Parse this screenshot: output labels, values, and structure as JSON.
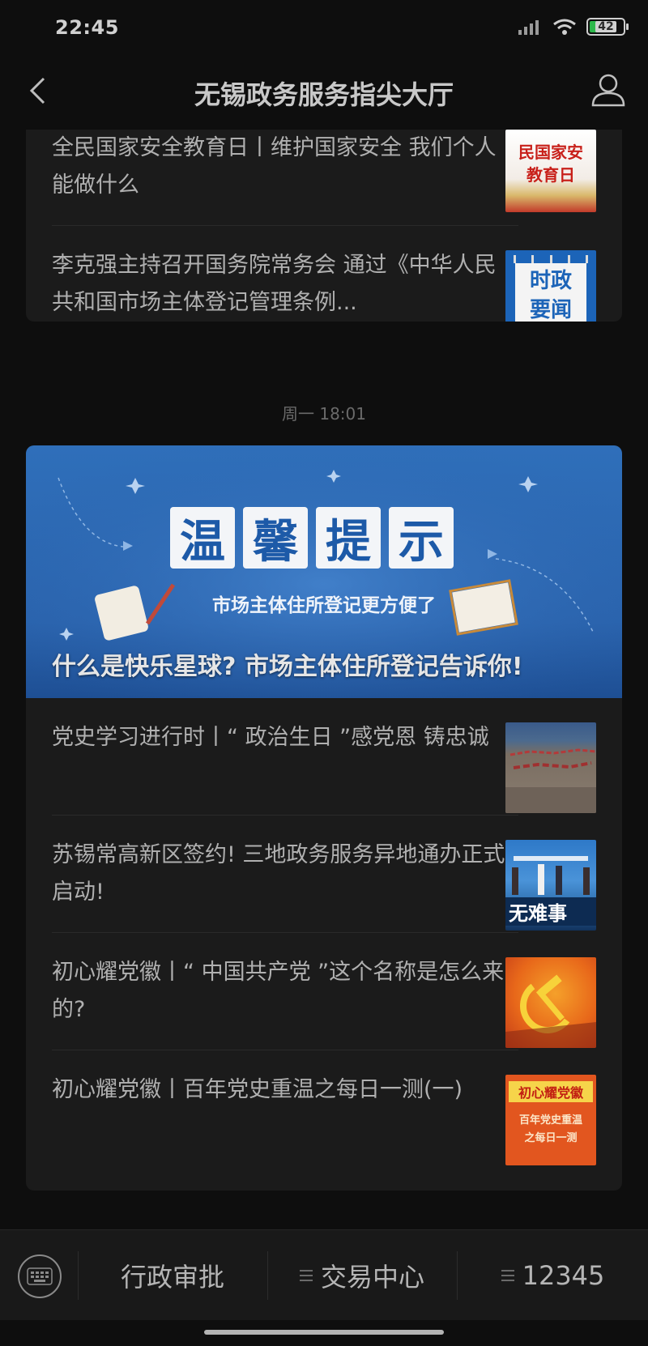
{
  "status_bar": {
    "time": "22:45",
    "battery_level": "42"
  },
  "nav": {
    "title": "无锡政务服务指尖大厅"
  },
  "card_1": {
    "items": [
      {
        "title": "全民国家安全教育日丨维护国家安全 我们个人能做什么",
        "thumb_text": [
          "民国家安",
          "教育日"
        ]
      },
      {
        "title": "李克强主持召开国务院常务会 通过《中华人民共和国市场主体登记管理条例...",
        "thumb_text": [
          "时政",
          "要闻"
        ]
      }
    ]
  },
  "timestamp": "周一 18:01",
  "card_2": {
    "banner": {
      "heading_chars": [
        "温",
        "馨",
        "提",
        "示"
      ],
      "subheading": "市场主体住所登记更方便了",
      "caption": "什么是快乐星球? 市场主体住所登记告诉你!"
    },
    "items": [
      {
        "title": "党史学习进行时丨“ 政治生日 ”感党恩 铸忠诚"
      },
      {
        "title": "苏锡常高新区签约! 三地政务服务异地通办正式启动!",
        "thumb_text": "无难事"
      },
      {
        "title": "初心耀党徽丨“ 中国共产党 ”这个名称是怎么来的?"
      },
      {
        "title": "初心耀党徽丨百年党史重温之每日一测(一)",
        "thumb_text": [
          "初心耀党徽",
          "百年党史重温",
          "之每日一测"
        ]
      }
    ]
  },
  "bottom_menu": {
    "items": [
      {
        "label": "行政审批"
      },
      {
        "label": "交易中心"
      },
      {
        "label": "12345"
      }
    ]
  }
}
